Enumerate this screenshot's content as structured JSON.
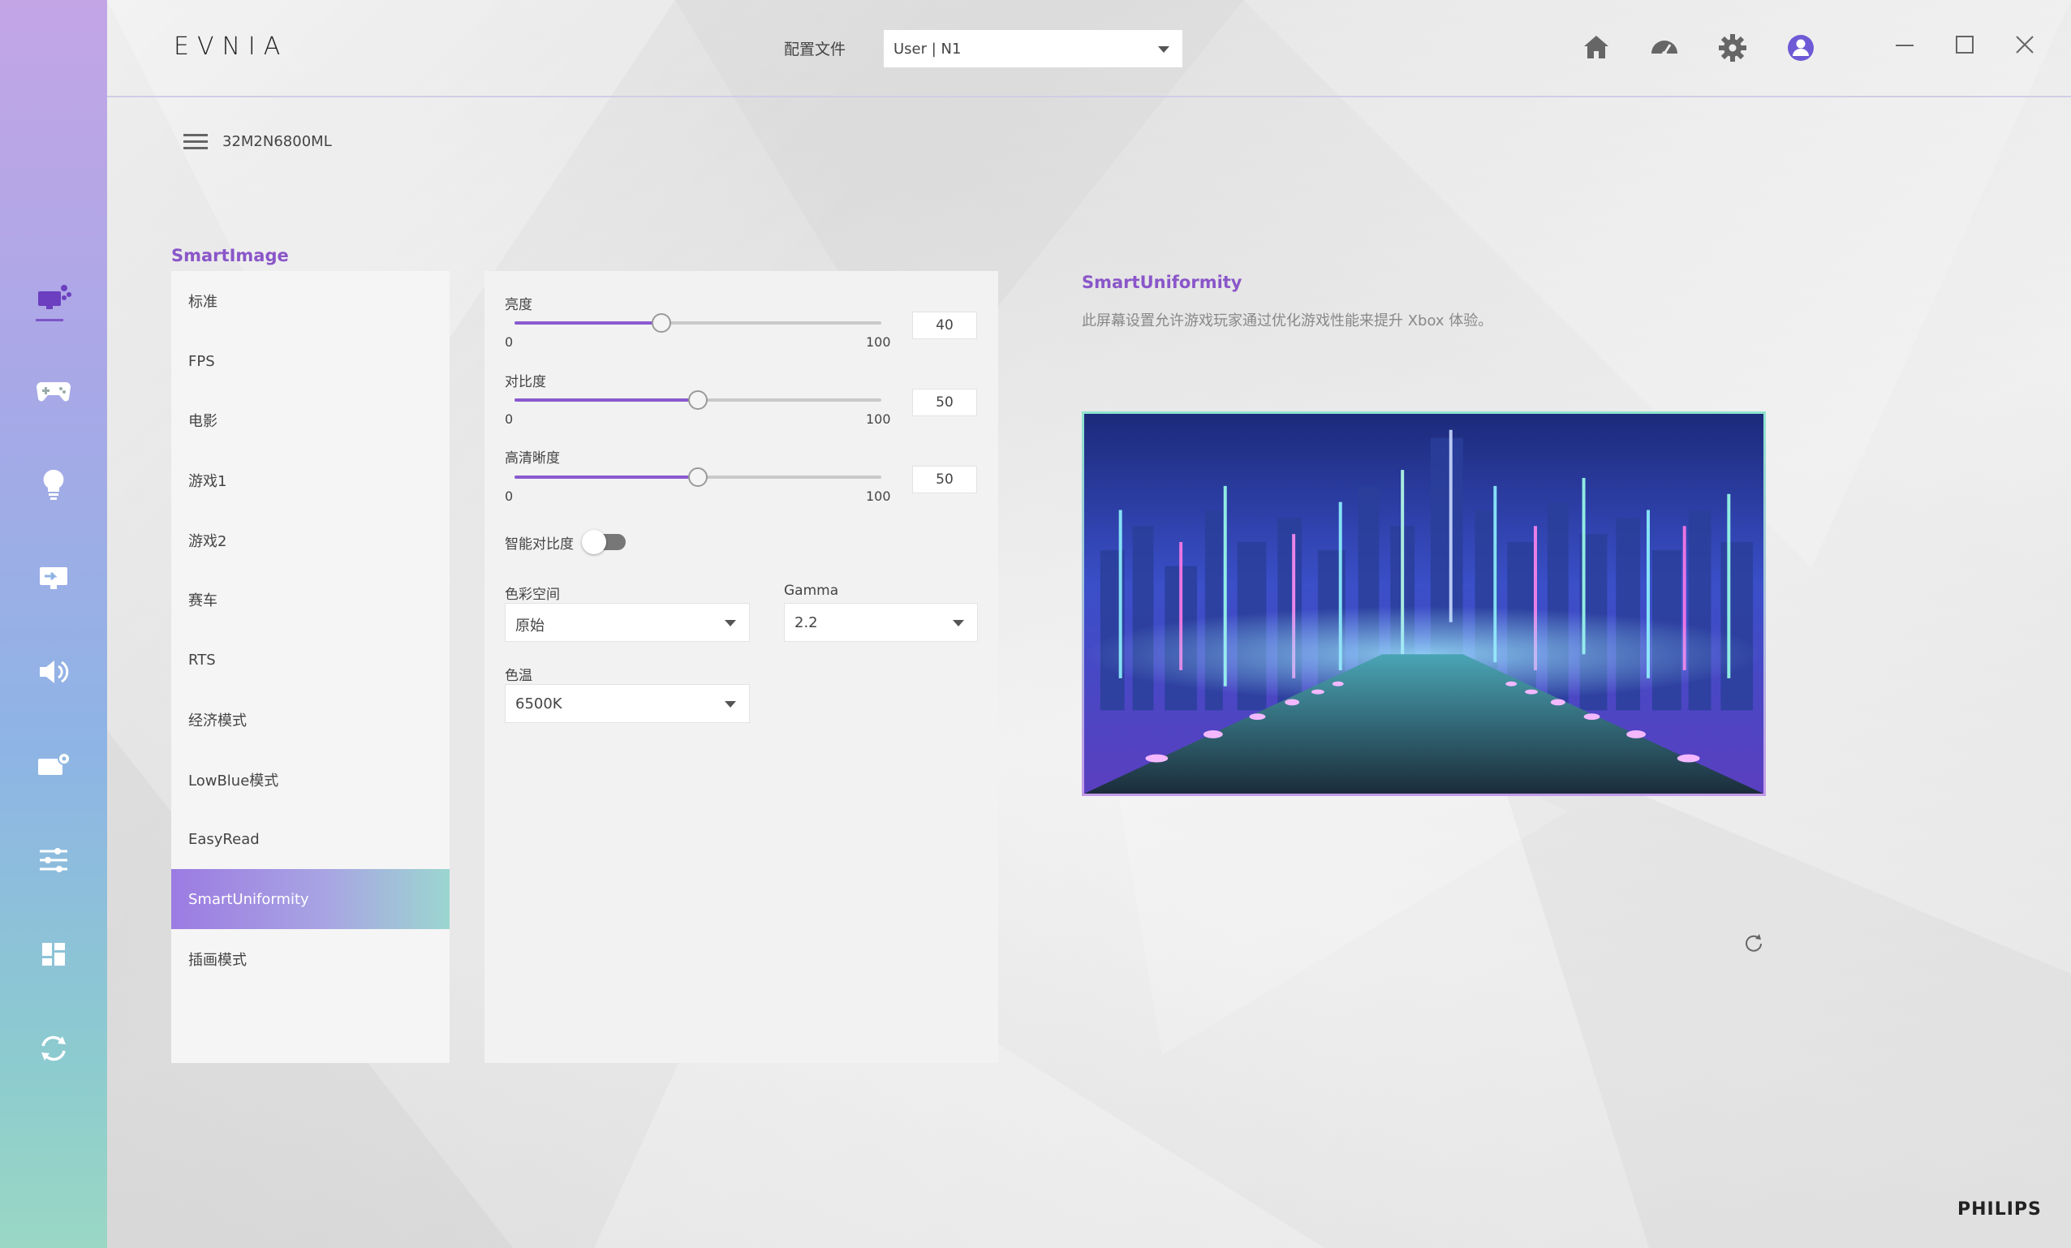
{
  "header": {
    "brand": "EVNIA",
    "profile_label": "配置文件",
    "profile_value": "User | N1"
  },
  "device": {
    "name": "32M2N6800ML"
  },
  "smartimage": {
    "title": "SmartImage",
    "modes": [
      {
        "label": "标准",
        "active": false
      },
      {
        "label": "FPS",
        "active": false
      },
      {
        "label": "电影",
        "active": false
      },
      {
        "label": "游戏1",
        "active": false
      },
      {
        "label": "游戏2",
        "active": false
      },
      {
        "label": "赛车",
        "active": false
      },
      {
        "label": "RTS",
        "active": false
      },
      {
        "label": "经济模式",
        "active": false
      },
      {
        "label": "LowBlue模式",
        "active": false
      },
      {
        "label": "EasyRead",
        "active": false
      },
      {
        "label": "SmartUniformity",
        "active": true
      },
      {
        "label": "插画模式",
        "active": false
      }
    ]
  },
  "settings": {
    "brightness": {
      "label": "亮度",
      "value": "40",
      "min": "0",
      "max": "100",
      "fraction": 0.4
    },
    "contrast": {
      "label": "对比度",
      "value": "50",
      "min": "0",
      "max": "100",
      "fraction": 0.5
    },
    "sharpness": {
      "label": "高清晰度",
      "value": "50",
      "min": "0",
      "max": "100",
      "fraction": 0.5
    },
    "smart_contrast": {
      "label": "智能对比度",
      "on": false
    },
    "color_space": {
      "label": "色彩空间",
      "value": "原始"
    },
    "gamma": {
      "label": "Gamma",
      "value": "2.2"
    },
    "color_temp": {
      "label": "色温",
      "value": "6500K"
    }
  },
  "info": {
    "title": "SmartUniformity",
    "description": "此屏幕设置允许游戏玩家通过优化游戏性能来提升 Xbox 体验。"
  },
  "footer": {
    "brand": "PHILIPS"
  },
  "colors": {
    "accent": "#8a56c9",
    "slider_fill": "#8a5ad0"
  }
}
